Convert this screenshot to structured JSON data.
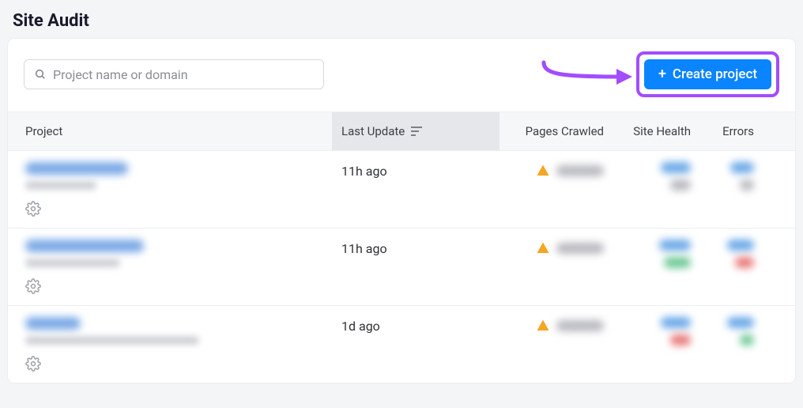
{
  "page": {
    "title": "Site Audit"
  },
  "search": {
    "placeholder": "Project name or domain"
  },
  "actions": {
    "create_label": "Create project"
  },
  "columns": {
    "project": "Project",
    "last_update": "Last Update",
    "pages_crawled": "Pages Crawled",
    "site_health": "Site Health",
    "errors": "Errors"
  },
  "rows": [
    {
      "last_update": "11h ago"
    },
    {
      "last_update": "11h ago"
    },
    {
      "last_update": "1d ago"
    }
  ],
  "colors": {
    "primary": "#0a84ff",
    "highlight_border": "#a24dff"
  }
}
